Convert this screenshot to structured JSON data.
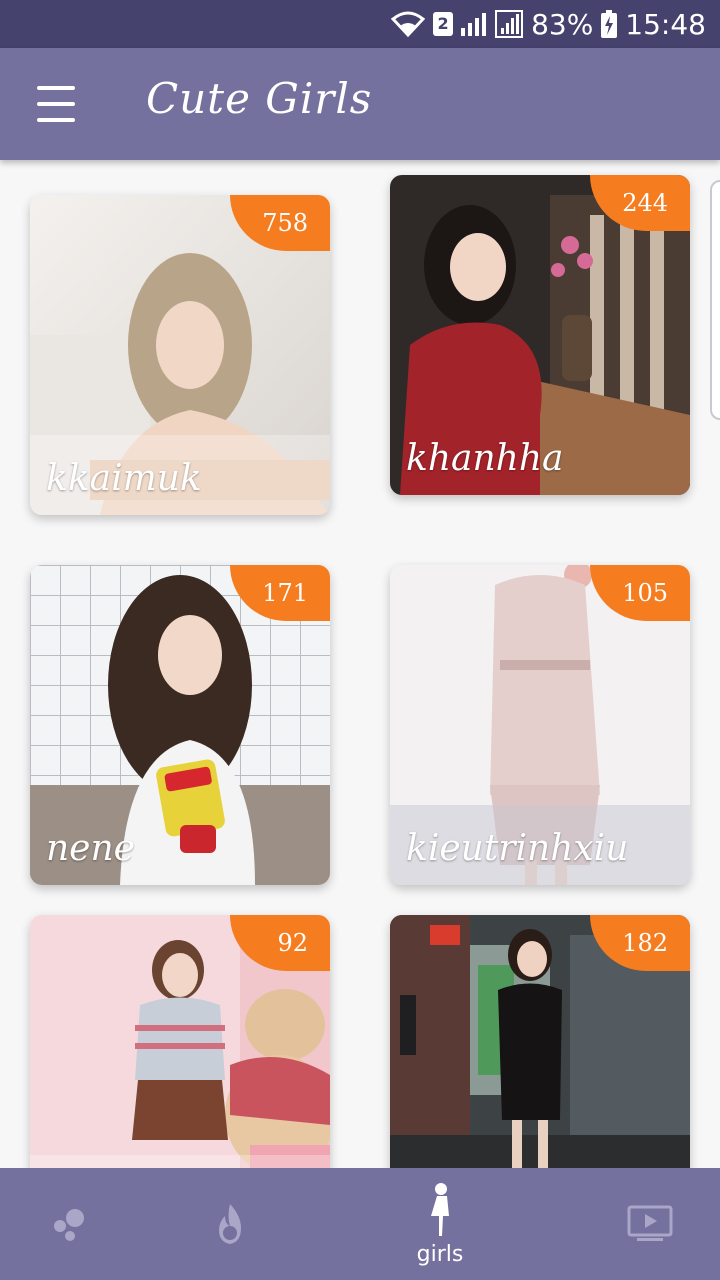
{
  "status_bar": {
    "sim_slot": "2",
    "battery": "83%",
    "time": "15:48"
  },
  "app_bar": {
    "title": "Cute Girls",
    "menu_icon": "hamburger-menu-icon"
  },
  "cards": [
    {
      "name": "kkaimuk",
      "count": "758"
    },
    {
      "name": "khanhha",
      "count": "244"
    },
    {
      "name": "nene",
      "count": "171"
    },
    {
      "name": "kieutrinhxiu",
      "count": "105"
    },
    {
      "name": "",
      "count": "92"
    },
    {
      "name": "",
      "count": "182"
    }
  ],
  "bottom_nav": {
    "items": [
      {
        "icon": "dots-icon",
        "label": ""
      },
      {
        "icon": "flame-icon",
        "label": ""
      },
      {
        "icon": "girl-silhouette-icon",
        "label": "girls",
        "active": true
      },
      {
        "icon": "video-play-icon",
        "label": ""
      }
    ]
  },
  "colors": {
    "status_bar": "#45426e",
    "app_bar": "#74719e",
    "badge": "#f57c1f",
    "background": "#f7f7f8"
  }
}
